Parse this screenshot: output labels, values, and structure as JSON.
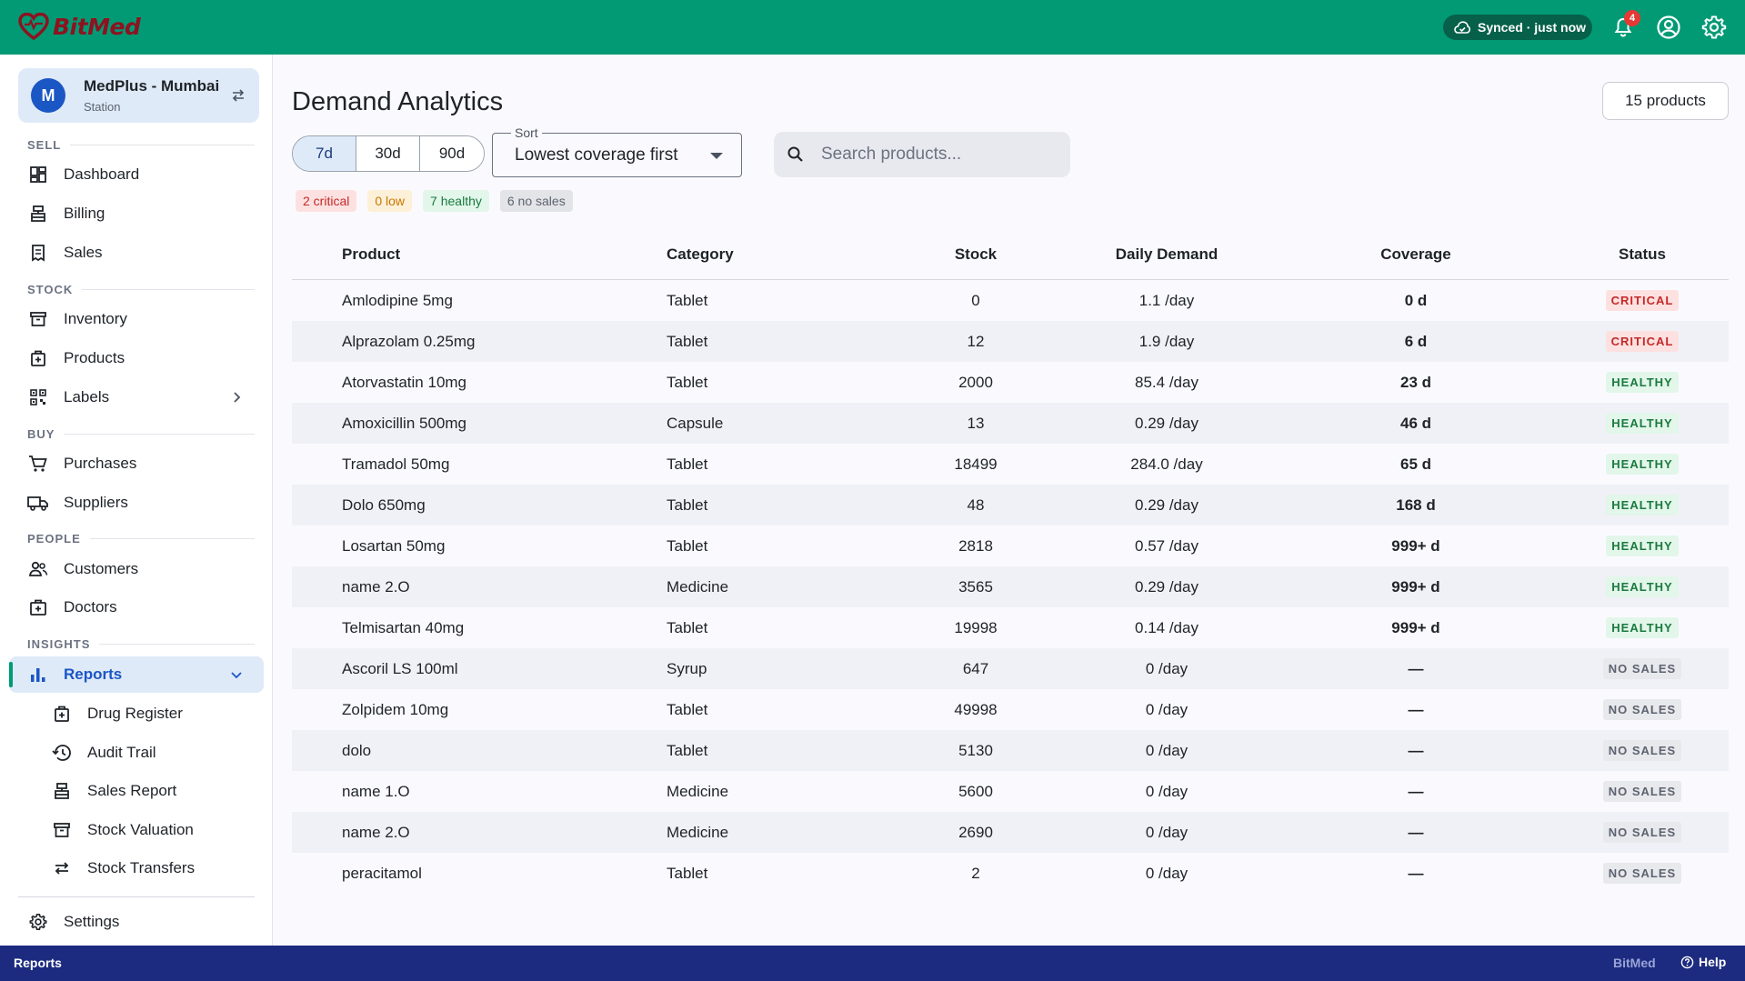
{
  "app": {
    "name": "BitMed"
  },
  "topbar": {
    "sync_status": "Synced · just now",
    "notification_count": "4"
  },
  "sidebar": {
    "station": {
      "initial": "M",
      "name": "MedPlus - Mumbai",
      "type": "Station"
    },
    "sections": {
      "sell": "SELL",
      "stock": "STOCK",
      "buy": "BUY",
      "people": "PEOPLE",
      "insights": "INSIGHTS"
    },
    "items": {
      "dashboard": "Dashboard",
      "billing": "Billing",
      "sales": "Sales",
      "inventory": "Inventory",
      "products": "Products",
      "labels": "Labels",
      "purchases": "Purchases",
      "suppliers": "Suppliers",
      "customers": "Customers",
      "doctors": "Doctors",
      "reports": "Reports",
      "drug_register": "Drug Register",
      "audit_trail": "Audit Trail",
      "sales_report": "Sales Report",
      "stock_valuation": "Stock Valuation",
      "stock_transfers": "Stock Transfers",
      "settings": "Settings"
    }
  },
  "main": {
    "title": "Demand Analytics",
    "product_count": "15 products",
    "ranges": [
      "7d",
      "30d",
      "90d"
    ],
    "selected_range": "7d",
    "sort": {
      "label": "Sort",
      "value": "Lowest coverage first"
    },
    "search": {
      "placeholder": "Search products..."
    },
    "chips": {
      "critical": "2 critical",
      "low": "0 low",
      "healthy": "7 healthy",
      "nosales": "6 no sales"
    },
    "colors": {
      "critical": "#c62828",
      "low": "#c77800",
      "healthy": "#1b7a3f",
      "nosales": "#5c6370"
    },
    "columns": [
      "Product",
      "Category",
      "Stock",
      "Daily Demand",
      "Coverage",
      "Status"
    ],
    "rows": [
      {
        "product": "Amlodipine 5mg",
        "category": "Tablet",
        "stock": "0",
        "demand": "1.1 /day",
        "coverage": "0 d",
        "status": "CRITICAL",
        "kind": "critical"
      },
      {
        "product": "Alprazolam 0.25mg",
        "category": "Tablet",
        "stock": "12",
        "demand": "1.9 /day",
        "coverage": "6 d",
        "status": "CRITICAL",
        "kind": "critical"
      },
      {
        "product": "Atorvastatin 10mg",
        "category": "Tablet",
        "stock": "2000",
        "demand": "85.4 /day",
        "coverage": "23 d",
        "status": "HEALTHY",
        "kind": "healthy"
      },
      {
        "product": "Amoxicillin 500mg",
        "category": "Capsule",
        "stock": "13",
        "demand": "0.29 /day",
        "coverage": "46 d",
        "status": "HEALTHY",
        "kind": "healthy"
      },
      {
        "product": "Tramadol 50mg",
        "category": "Tablet",
        "stock": "18499",
        "demand": "284.0 /day",
        "coverage": "65 d",
        "status": "HEALTHY",
        "kind": "healthy"
      },
      {
        "product": "Dolo 650mg",
        "category": "Tablet",
        "stock": "48",
        "demand": "0.29 /day",
        "coverage": "168 d",
        "status": "HEALTHY",
        "kind": "healthy"
      },
      {
        "product": "Losartan 50mg",
        "category": "Tablet",
        "stock": "2818",
        "demand": "0.57 /day",
        "coverage": "999+ d",
        "status": "HEALTHY",
        "kind": "healthy"
      },
      {
        "product": "name 2.O",
        "category": "Medicine",
        "stock": "3565",
        "demand": "0.29 /day",
        "coverage": "999+ d",
        "status": "HEALTHY",
        "kind": "healthy"
      },
      {
        "product": "Telmisartan 40mg",
        "category": "Tablet",
        "stock": "19998",
        "demand": "0.14 /day",
        "coverage": "999+ d",
        "status": "HEALTHY",
        "kind": "healthy"
      },
      {
        "product": "Ascoril LS 100ml",
        "category": "Syrup",
        "stock": "647",
        "demand": "0 /day",
        "coverage": "—",
        "status": "NO SALES",
        "kind": "nosales"
      },
      {
        "product": "Zolpidem 10mg",
        "category": "Tablet",
        "stock": "49998",
        "demand": "0 /day",
        "coverage": "—",
        "status": "NO SALES",
        "kind": "nosales"
      },
      {
        "product": "dolo",
        "category": "Tablet",
        "stock": "5130",
        "demand": "0 /day",
        "coverage": "—",
        "status": "NO SALES",
        "kind": "nosales"
      },
      {
        "product": "name 1.O",
        "category": "Medicine",
        "stock": "5600",
        "demand": "0 /day",
        "coverage": "—",
        "status": "NO SALES",
        "kind": "nosales"
      },
      {
        "product": "name 2.O",
        "category": "Medicine",
        "stock": "2690",
        "demand": "0 /day",
        "coverage": "—",
        "status": "NO SALES",
        "kind": "nosales"
      },
      {
        "product": "peracitamol",
        "category": "Tablet",
        "stock": "2",
        "demand": "0 /day",
        "coverage": "—",
        "status": "NO SALES",
        "kind": "nosales"
      }
    ]
  },
  "statusbar": {
    "page": "Reports",
    "brand": "BitMed",
    "help": "Help"
  }
}
